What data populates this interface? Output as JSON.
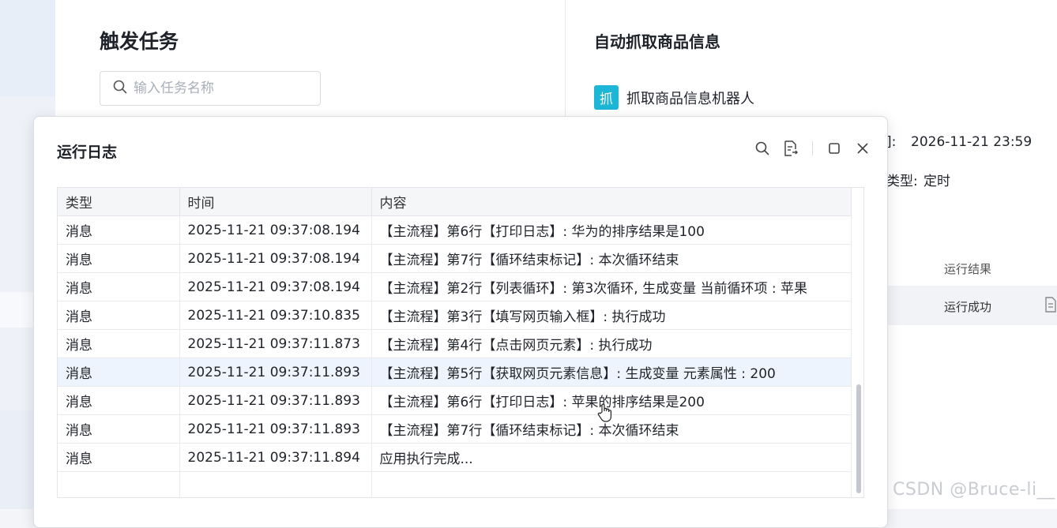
{
  "page": {
    "title": "触发任务",
    "search_placeholder": "输入任务名称"
  },
  "detail": {
    "title": "自动抓取商品信息",
    "robot_badge": "抓",
    "robot_name": "抓取商品信息机器人",
    "row1_label": "]:",
    "row1_value": "2026-11-21 23:59",
    "row2_label": "类型:",
    "row2_value": "定时",
    "result_header": "运行结果",
    "result_value": "运行成功"
  },
  "dialog": {
    "title": "运行日志",
    "columns": [
      "类型",
      "时间",
      "内容"
    ],
    "rows": [
      {
        "type": "消息",
        "time": "2025-11-21 09:37:08.194",
        "content": "【主流程】第6行【打印日志】: 华为的排序结果是100"
      },
      {
        "type": "消息",
        "time": "2025-11-21 09:37:08.194",
        "content": "【主流程】第7行【循环结束标记】: 本次循环结束"
      },
      {
        "type": "消息",
        "time": "2025-11-21 09:37:08.194",
        "content": "【主流程】第2行【列表循环】: 第3次循环, 生成变量 当前循环项 : 苹果"
      },
      {
        "type": "消息",
        "time": "2025-11-21 09:37:10.835",
        "content": "【主流程】第3行【填写网页输入框】: 执行成功"
      },
      {
        "type": "消息",
        "time": "2025-11-21 09:37:11.873",
        "content": "【主流程】第4行【点击网页元素】: 执行成功"
      },
      {
        "type": "消息",
        "time": "2025-11-21 09:37:11.893",
        "content": "【主流程】第5行【获取网页元素信息】: 生成变量 元素属性 : 200"
      },
      {
        "type": "消息",
        "time": "2025-11-21 09:37:11.893",
        "content": "【主流程】第6行【打印日志】: 苹果的排序结果是200"
      },
      {
        "type": "消息",
        "time": "2025-11-21 09:37:11.893",
        "content": "【主流程】第7行【循环结束标记】: 本次循环结束"
      },
      {
        "type": "消息",
        "time": "2025-11-21 09:37:11.894",
        "content": "应用执行完成..."
      }
    ],
    "highlighted_row": 5
  },
  "icons": {
    "search": "search-icon",
    "export": "export-log-icon",
    "maximize": "maximize-icon",
    "close": "close-icon",
    "document": "document-icon",
    "cursor": "hand-cursor-icon"
  },
  "colors": {
    "accent": "#1cb6d6",
    "highlight_row": "#eef4fd"
  },
  "watermark": "CSDN @Bruce-li__"
}
